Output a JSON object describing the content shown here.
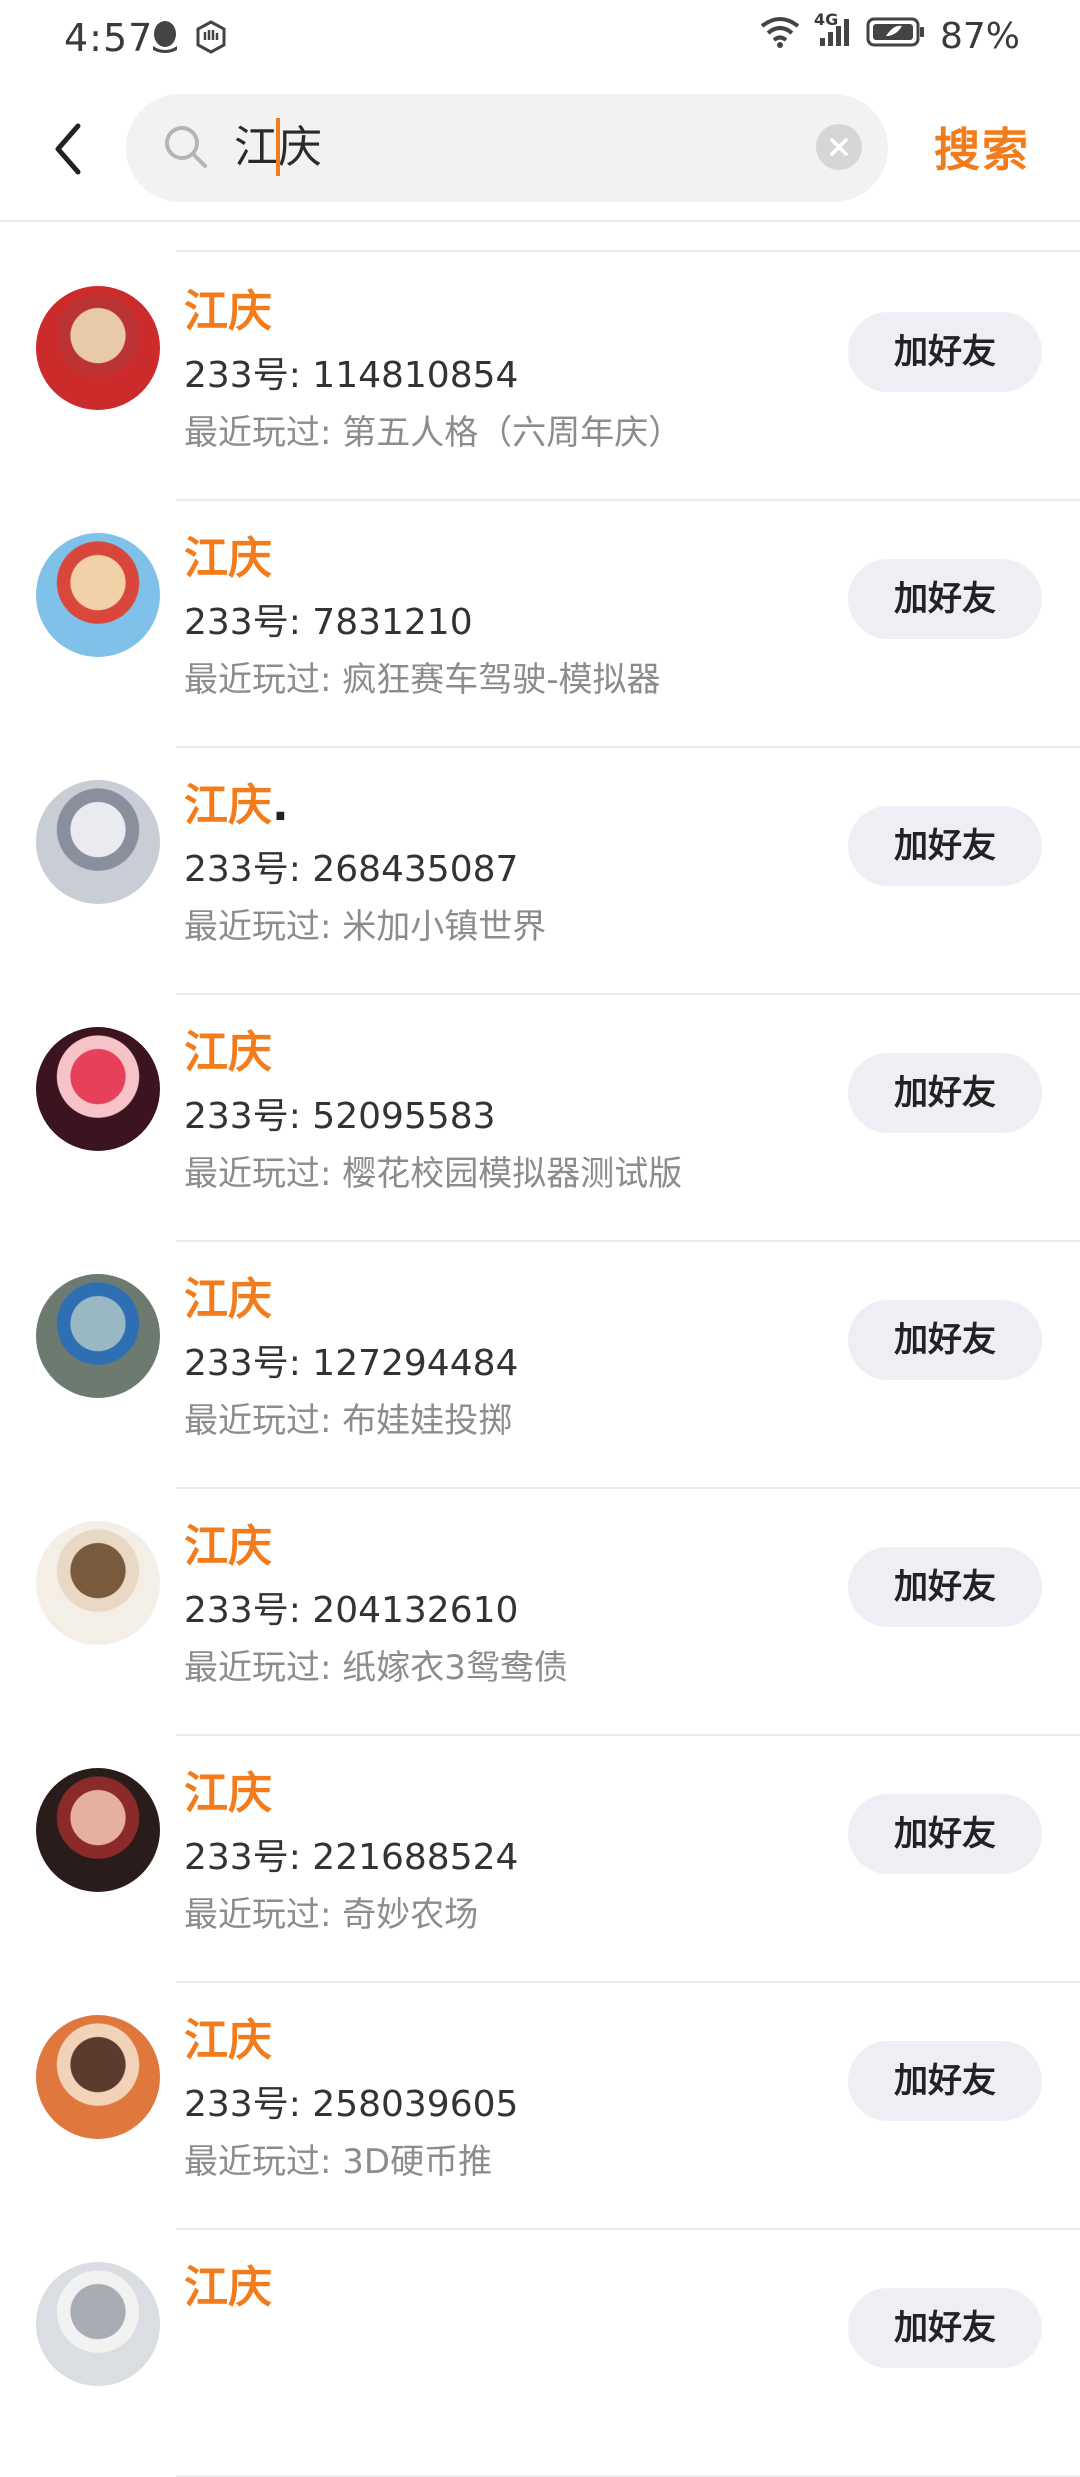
{
  "status_bar": {
    "time": "4:57",
    "network": "4G",
    "battery": "87%"
  },
  "header": {
    "search_value": "江庆",
    "search_button": "搜索"
  },
  "results": [
    {
      "name": "江庆",
      "suffix": "",
      "uid": "233号: 114810854",
      "played": "最近玩过: 第五人格（六周年庆）",
      "button": "加好友",
      "avatar_colors": [
        "#cc2b2b",
        "#e8c9a8",
        "#b33"
      ]
    },
    {
      "name": "江庆",
      "suffix": "",
      "uid": "233号: 7831210",
      "played": "最近玩过: 疯狂赛车驾驶-模拟器",
      "button": "加好友",
      "avatar_colors": [
        "#7fc1e8",
        "#f2d1a8",
        "#d9463b"
      ]
    },
    {
      "name": "江庆",
      "suffix": ".",
      "uid": "233号: 268435087",
      "played": "最近玩过: 米加小镇世界",
      "button": "加好友",
      "avatar_colors": [
        "#c9cdd6",
        "#e9ebf0",
        "#8a8f9e"
      ]
    },
    {
      "name": "江庆",
      "suffix": "",
      "uid": "233号: 52095583",
      "played": "最近玩过: 樱花校园模拟器测试版",
      "button": "加好友",
      "avatar_colors": [
        "#3b1420",
        "#e6405a",
        "#f5c3c8"
      ]
    },
    {
      "name": "江庆",
      "suffix": "",
      "uid": "233号: 127294484",
      "played": "最近玩过: 布娃娃投掷",
      "button": "加好友",
      "avatar_colors": [
        "#6d7a70",
        "#9ab8c4",
        "#2e6fb3"
      ]
    },
    {
      "name": "江庆",
      "suffix": "",
      "uid": "233号: 204132610",
      "played": "最近玩过: 纸嫁衣3鸳鸯债",
      "button": "加好友",
      "avatar_colors": [
        "#f3efe7",
        "#7a5a3c",
        "#e9d9c4"
      ]
    },
    {
      "name": "江庆",
      "suffix": "",
      "uid": "233号: 221688524",
      "played": "最近玩过: 奇妙农场",
      "button": "加好友",
      "avatar_colors": [
        "#2b1c1c",
        "#e6b0a0",
        "#8a2a2a"
      ]
    },
    {
      "name": "江庆",
      "suffix": "",
      "uid": "233号: 258039605",
      "played": "最近玩过: 3D硬币推",
      "button": "加好友",
      "avatar_colors": [
        "#e0783e",
        "#5a3b2e",
        "#f2d3b8"
      ]
    },
    {
      "name": "江庆",
      "suffix": "",
      "uid": "",
      "played": "",
      "button": "加好友",
      "avatar_colors": [
        "#dadde2",
        "#a8adb5",
        "#f2f2f2"
      ]
    }
  ]
}
